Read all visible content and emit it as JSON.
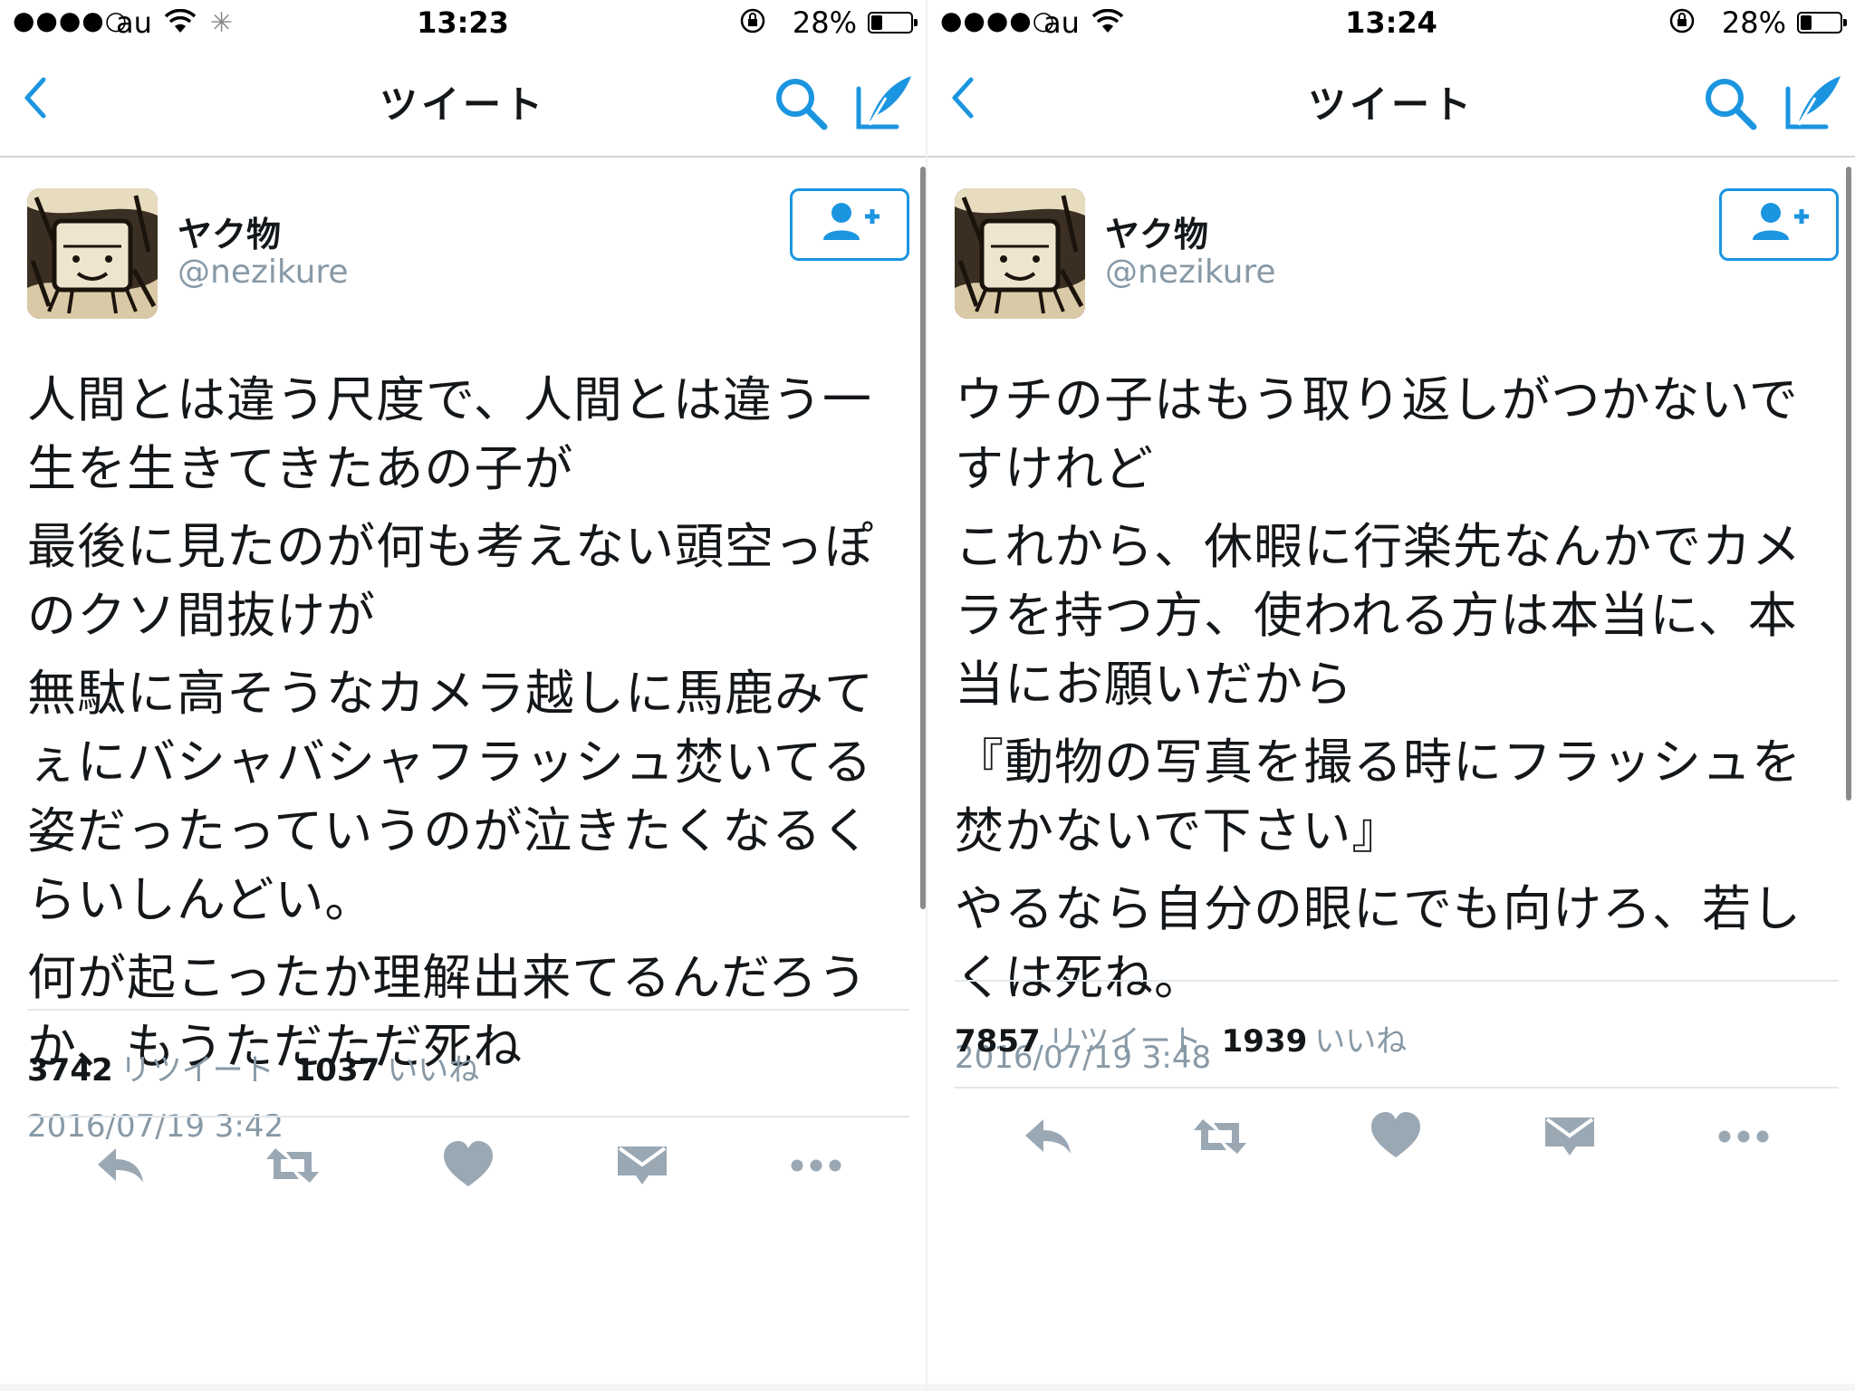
{
  "colors": {
    "accent": "#1b95e0",
    "text": "#14171a",
    "muted": "#8899a6",
    "border": "#e1e8ed"
  },
  "left": {
    "status_bar": {
      "signal": "●●●●○",
      "carrier": "au",
      "time": "13:23",
      "battery_pct": "28%",
      "battery_level": 0.28,
      "icons": [
        "wifi-icon",
        "activity-spinner-icon",
        "orientation-lock-icon",
        "battery-icon"
      ]
    },
    "nav": {
      "title": "ツイート"
    },
    "tweet": {
      "display_name": "ヤク物",
      "screen_name": "@nezikure",
      "paragraphs": [
        "人間とは違う尺度で、人間とは違う一生を生きてきたあの子が",
        "最後に見たのが何も考えない頭空っぽのクソ間抜けが",
        "無駄に高そうなカメラ越しに馬鹿みてぇにバシャバシャフラッシュ焚いてる姿だったっていうのが泣きたくなるくらいしんどい。",
        "何が起こったか理解出来てるんだろうか、もうただただ死ね"
      ],
      "timestamp": "2016/07/19 3:42",
      "retweet_count": "3742",
      "retweet_label": "リツイート",
      "like_count": "1037",
      "like_label": "いいね"
    }
  },
  "right": {
    "status_bar": {
      "signal": "●●●●○",
      "carrier": "au",
      "time": "13:24",
      "battery_pct": "28%",
      "battery_level": 0.28,
      "icons": [
        "wifi-icon",
        "orientation-lock-icon",
        "battery-icon"
      ]
    },
    "nav": {
      "title": "ツイート"
    },
    "tweet": {
      "display_name": "ヤク物",
      "screen_name": "@nezikure",
      "paragraphs": [
        "ウチの子はもう取り返しがつかないですけれど",
        "これから、休暇に行楽先なんかでカメラを持つ方、使われる方は本当に、本当にお願いだから",
        "『動物の写真を撮る時にフラッシュを焚かないで下さい』",
        "やるなら自分の眼にでも向けろ、若しくは死ね。"
      ],
      "timestamp": "2016/07/19 3:48",
      "retweet_count": "7857",
      "retweet_label": "リツイート",
      "like_count": "1939",
      "like_label": "いいね"
    }
  }
}
